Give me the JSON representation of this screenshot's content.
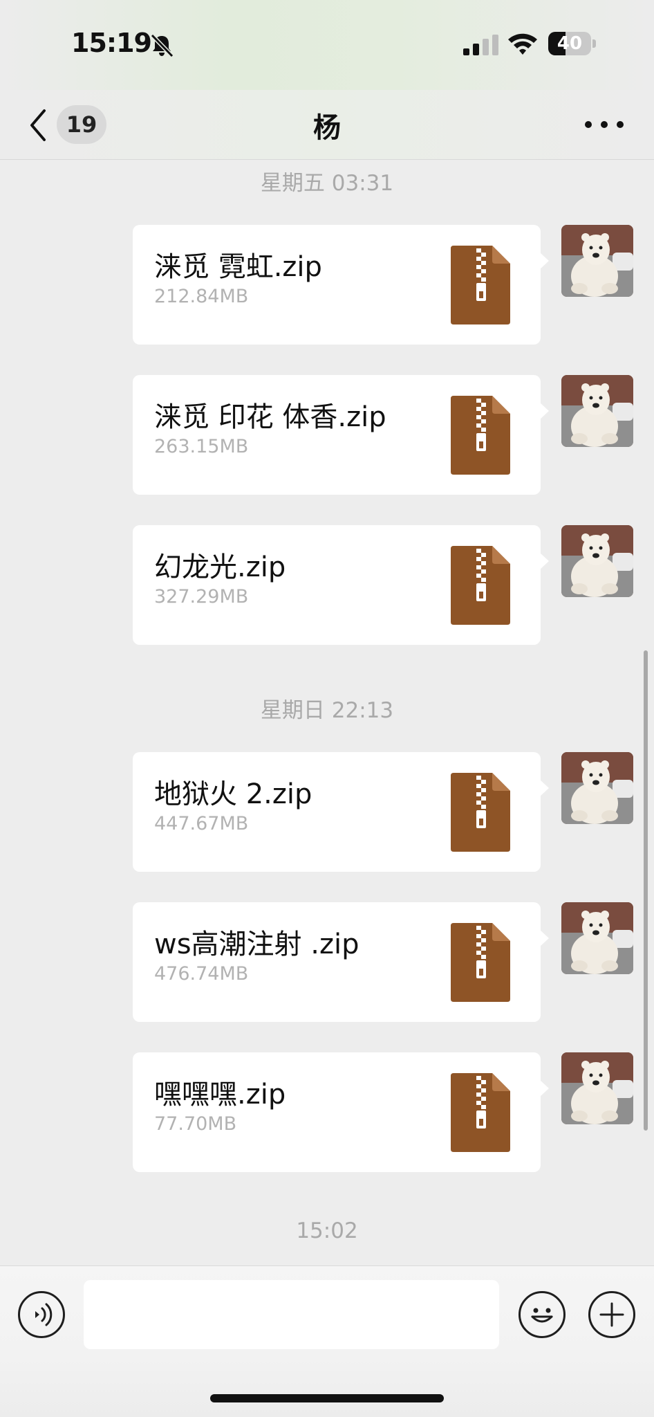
{
  "status_bar": {
    "time": "15:19",
    "battery_level": "40",
    "icons": [
      "bell-off-icon",
      "signal-icon",
      "wifi-icon",
      "battery-icon"
    ]
  },
  "nav": {
    "unread_count": "19",
    "title": "杨",
    "icons": [
      "chevron-left-icon",
      "more-icon"
    ]
  },
  "chat": {
    "timestamps": [
      "星期五 03:31",
      "星期日 22:13",
      "15:02"
    ],
    "messages": [
      {
        "file_name": "涞觅 霓虹.zip",
        "file_size": "212.84MB"
      },
      {
        "file_name": "涞觅 印花 体香.zip",
        "file_size": "263.15MB"
      },
      {
        "file_name": "幻龙光.zip",
        "file_size": "327.29MB"
      },
      {
        "file_name": "地狱火 2.zip",
        "file_size": "447.67MB"
      },
      {
        "file_name": "ws高潮注射 .zip",
        "file_size": "476.74MB"
      },
      {
        "file_name": "嘿嘿嘿.zip",
        "file_size": "77.70MB"
      }
    ],
    "file_icon": "zip-file-icon",
    "file_icon_color": "#8e5426"
  },
  "input_bar": {
    "text_value": "",
    "icons": [
      "voice-icon",
      "emoji-icon",
      "plus-icon"
    ]
  }
}
